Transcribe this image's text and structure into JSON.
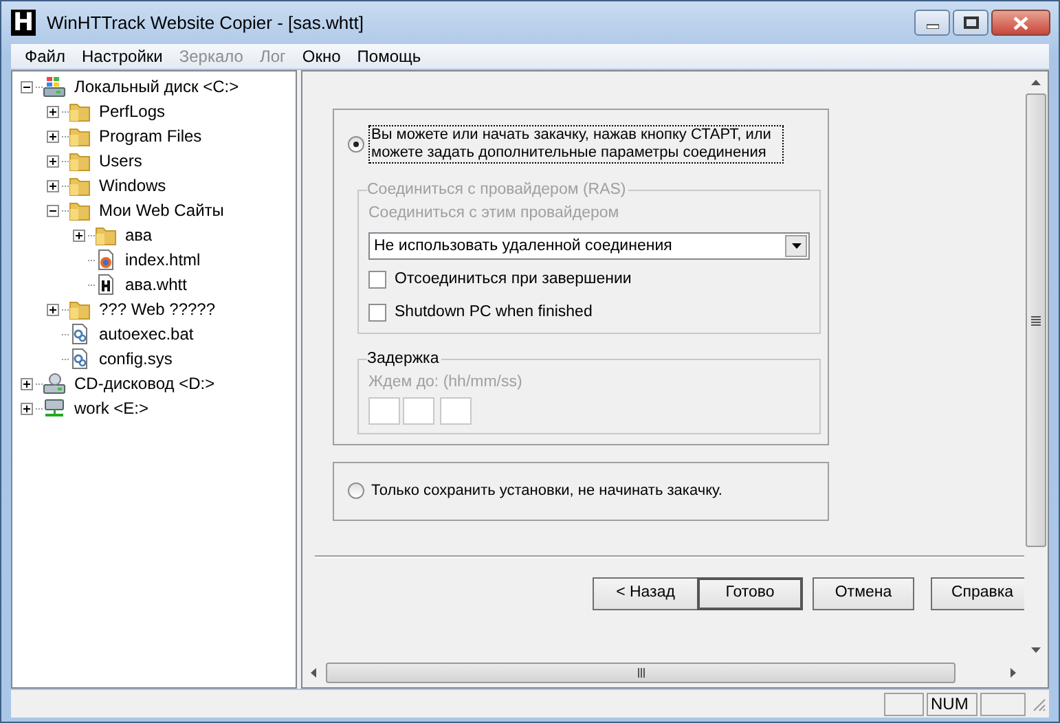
{
  "window": {
    "logo": "H",
    "title": "WinHTTrack Website Copier - [sas.whtt]"
  },
  "menu": [
    {
      "label": "Файл",
      "disabled": false
    },
    {
      "label": "Настройки",
      "disabled": false
    },
    {
      "label": "Зеркало",
      "disabled": true
    },
    {
      "label": "Лог",
      "disabled": true
    },
    {
      "label": "Окно",
      "disabled": false
    },
    {
      "label": "Помощь",
      "disabled": false
    }
  ],
  "tree": [
    {
      "label": "Локальный диск <C:>",
      "kind": "drive",
      "expanded": true,
      "children": [
        {
          "label": "PerfLogs",
          "kind": "folder",
          "expanded": false
        },
        {
          "label": "Program Files",
          "kind": "folder",
          "expanded": false
        },
        {
          "label": "Users",
          "kind": "folder",
          "expanded": false
        },
        {
          "label": "Windows",
          "kind": "folder",
          "expanded": false
        },
        {
          "label": "Мои Web Сайты",
          "kind": "folder",
          "expanded": true,
          "children": [
            {
              "label": "ава",
              "kind": "folder",
              "expanded": false
            },
            {
              "label": "index.html",
              "kind": "html"
            },
            {
              "label": "ава.whtt",
              "kind": "project"
            }
          ]
        },
        {
          "label": "??? Web ?????",
          "kind": "folder",
          "expanded": false
        },
        {
          "label": "autoexec.bat",
          "kind": "config"
        },
        {
          "label": "config.sys",
          "kind": "config"
        }
      ]
    },
    {
      "label": "CD-дисковод <D:>",
      "kind": "cdrom",
      "expanded": false
    },
    {
      "label": "work <E:>",
      "kind": "network",
      "expanded": false
    }
  ],
  "start_option": {
    "label": "Вы можете или начать закачку, нажав кнопку СТАРТ, или можете задать дополнительные параметры соединения",
    "selected": true,
    "focused": true
  },
  "ras_group": {
    "title": "Соединиться с провайдером (RAS)",
    "disabled": true,
    "provider_label": "Соединиться с этим провайдером",
    "provider_select": {
      "value": "Не использовать удаленной соединения"
    },
    "checkboxes": [
      {
        "label": "Отсоединиться при завершении",
        "checked": false
      },
      {
        "label": "Shutdown PC when finished",
        "checked": false
      }
    ]
  },
  "delay_group": {
    "title": "Задержка",
    "wait_label": "Ждем до: (hh/mm/ss)",
    "wait_label_disabled": true
  },
  "save_option": {
    "label": "Только сохранить установки, не начинать закачку.",
    "selected": false
  },
  "buttons": [
    {
      "label": "< Назад",
      "default": false
    },
    {
      "label": "Готово",
      "default": true
    },
    {
      "label": "Отмена",
      "default": false
    },
    {
      "label": "Справка",
      "default": false
    }
  ],
  "status_bar": {
    "indicator": "NUM"
  }
}
